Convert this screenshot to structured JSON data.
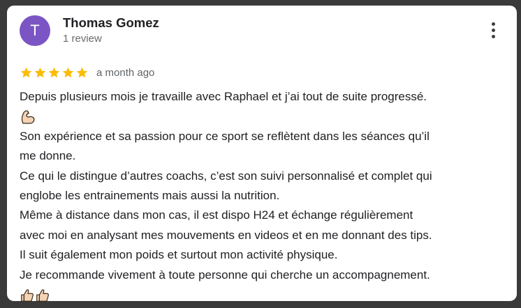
{
  "review": {
    "author": {
      "initial": "T",
      "name": "Thomas Gomez",
      "review_count": "1 review"
    },
    "rating": 5,
    "time_ago": "a month ago",
    "text_lines": [
      "Depuis plusieurs mois je travaille avec Raphael et j’ai tout de suite progressé.",
      "Son expérience et sa passion pour ce sport se reflètent dans les séances qu’il",
      "me donne.",
      "Ce qui le distingue d’autres coachs, c’est son suivi personnalisé et complet qui",
      "englobe les entrainements mais aussi la nutrition.",
      "Même à distance dans mon cas, il est dispo H24 et échange régulièrement",
      "avec moi en analysant mes mouvements en videos et en me donnant des tips.",
      "Il suit également mon poids et surtout mon activité physique.",
      "Je recommande vivement à toute personne qui cherche un accompagnement."
    ],
    "emojis": {
      "after_line_1": "flexed-biceps-icon",
      "closing": [
        "thumbs-up-icon",
        "thumbs-up-icon"
      ]
    }
  },
  "colors": {
    "avatar_bg": "#7b55c4",
    "star": "#fbbc04",
    "background": "#3a3a3a",
    "card": "#ffffff"
  }
}
